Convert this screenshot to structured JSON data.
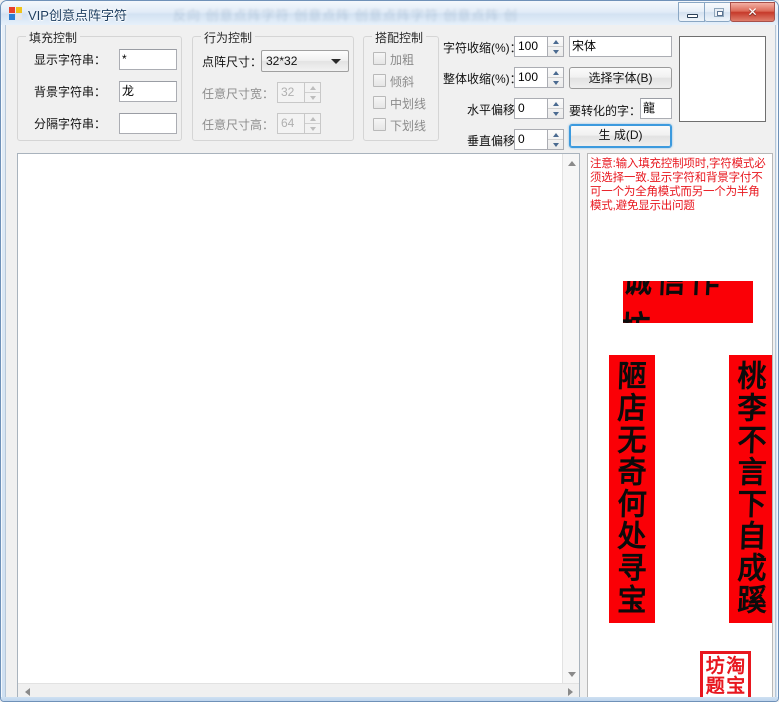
{
  "window": {
    "title": "VIP创意点阵字符",
    "title_ghost": "反向 创意点阵字符 创意点阵 创意点阵字符 创意点阵 创",
    "icon": "app-icon",
    "minimize_label": "",
    "maximize_label": "",
    "close_label": "✕"
  },
  "fill_control": {
    "legend": "填充控制",
    "display_string": {
      "label": "显示字符串：",
      "value": "*"
    },
    "background_string": {
      "label": "背景字符串：",
      "value": "龙"
    },
    "separator_string": {
      "label": "分隔字符串：",
      "value": ""
    }
  },
  "behavior_control": {
    "legend": "行为控制",
    "dot_size": {
      "label": "点阵尺寸：",
      "value": "32*32"
    },
    "custom_width": {
      "label": "任意尺寸宽：",
      "value": "32"
    },
    "custom_height": {
      "label": "任意尺寸高：",
      "value": "64"
    }
  },
  "style_control": {
    "legend": "搭配控制",
    "options": [
      {
        "label": "加粗",
        "checked": false
      },
      {
        "label": "倾斜",
        "checked": false
      },
      {
        "label": "中划线",
        "checked": false
      },
      {
        "label": "下划线",
        "checked": false
      }
    ]
  },
  "metrics": {
    "char_shrink": {
      "label": "字符收缩(%)：",
      "value": "100"
    },
    "whole_shrink": {
      "label": "整体收缩(%)：",
      "value": "100"
    },
    "h_offset": {
      "label": "水平偏移：",
      "value": "0"
    },
    "v_offset": {
      "label": "垂直偏移：",
      "value": "0"
    }
  },
  "font_area": {
    "font_name": "宋体",
    "choose_font_button": "选择字体(B)",
    "convert_char_label": "要转化的字：",
    "convert_char_value": "龍",
    "generate_button": "生 成(D)"
  },
  "right_panel": {
    "warning": "注意:输入填充控制项时,字符模式必须选择一致.显示字符和背景字付不可一个为全角模式而另一个为半角模式,避免显示出问题",
    "warning_color": "#e8171f",
    "banner_horizontal": "诚信作坊",
    "banner_left": [
      "陋",
      "店",
      "无",
      "奇",
      "何",
      "处",
      "寻",
      "宝"
    ],
    "banner_right": [
      "桃",
      "李",
      "不",
      "言",
      "下",
      "自",
      "成",
      "蹊"
    ],
    "seal": [
      "坊",
      "淘",
      "题",
      "宝"
    ],
    "banner_color": "#fa0006"
  },
  "canvas": {
    "content": "",
    "scroll_up": "▲",
    "scroll_down": "▼",
    "scroll_left": "◀",
    "scroll_right": "▶"
  }
}
